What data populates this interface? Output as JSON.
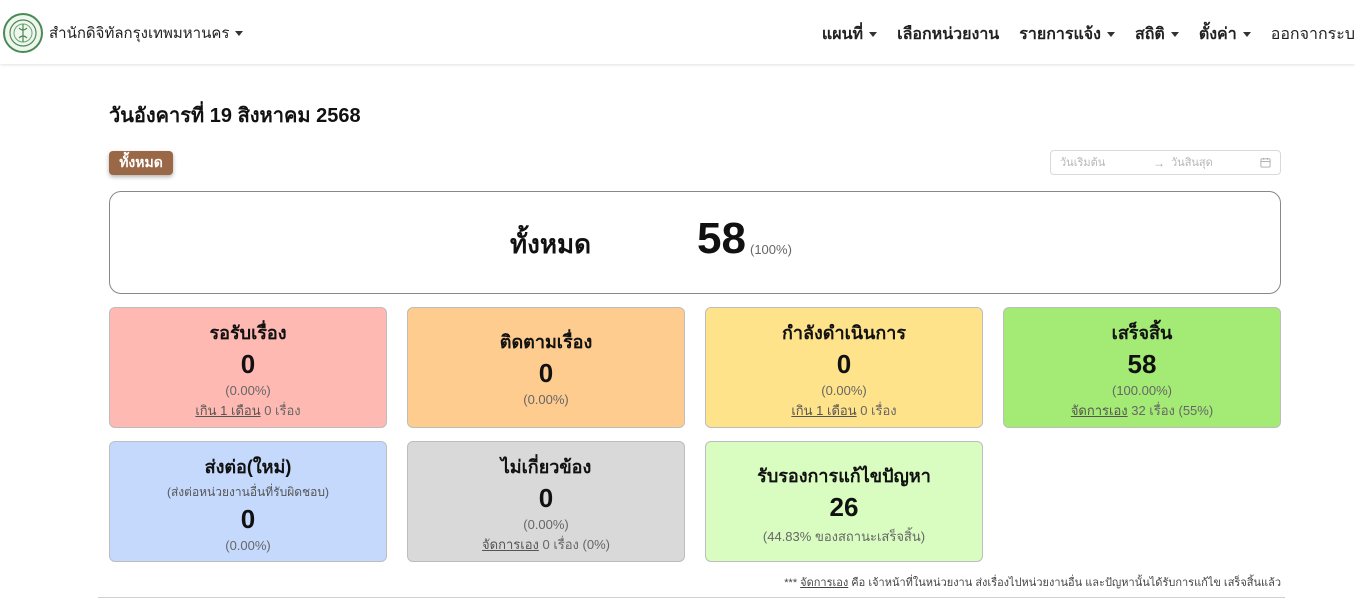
{
  "header": {
    "org_name": "สำนักดิจิทัลกรุงเทพมหานคร",
    "menu": [
      "แผนที่",
      "เลือกหน่วยงาน",
      "รายการแจ้ง",
      "สถิติ",
      "ตั้งค่า",
      "ออกจากระบ"
    ]
  },
  "page": {
    "date_title": "วันอังคารที่ 19 สิงหาคม 2568",
    "filter_button": "ทั้งหมด",
    "date_start_placeholder": "วันเริ่มต้น",
    "date_end_placeholder": "วันสิ้นสุด"
  },
  "summary": {
    "label": "ทั้งหมด",
    "value": "58",
    "percent": "(100%)"
  },
  "cards": {
    "waiting": {
      "title": "รอรับเรื่อง",
      "value": "0",
      "percent": "(0.00%)",
      "note_link": "เกิน 1 เดือน",
      "note_text": " 0 เรื่อง"
    },
    "following": {
      "title": "ติดตามเรื่อง",
      "value": "0",
      "percent": "(0.00%)"
    },
    "in_progress": {
      "title": "กำลังดำเนินการ",
      "value": "0",
      "percent": "(0.00%)",
      "note_link": "เกิน 1 เดือน",
      "note_text": " 0 เรื่อง"
    },
    "completed": {
      "title": "เสร็จสิ้น",
      "value": "58",
      "percent": "(100.00%)",
      "note_link": "จัดการเอง",
      "note_text": " 32 เรื่อง (55%)"
    },
    "forwarded": {
      "title": "ส่งต่อ(ใหม่)",
      "subtitle": "(ส่งต่อหน่วยงานอื่นที่รับผิดชอบ)",
      "value": "0",
      "percent": "(0.00%)"
    },
    "irrelevant": {
      "title": "ไม่เกี่ยวข้อง",
      "value": "0",
      "percent": "(0.00%)",
      "note_link": "จัดการเอง",
      "note_text": " 0 เรื่อง (0%)"
    },
    "certified": {
      "title": "รับรองการแก้ไขปัญหา",
      "value": "26",
      "percent": "(44.83% ของสถานะเสร็จสิ้น)"
    }
  },
  "footnote": {
    "prefix": "*** ",
    "link": "จัดการเอง",
    "text": " คือ เจ้าหน้าที่ในหน่วยงาน ส่งเรื่องไปหน่วยงานอื่น และปัญหานั้นได้รับการแก้ไข เสร็จสิ้นแล้ว"
  }
}
